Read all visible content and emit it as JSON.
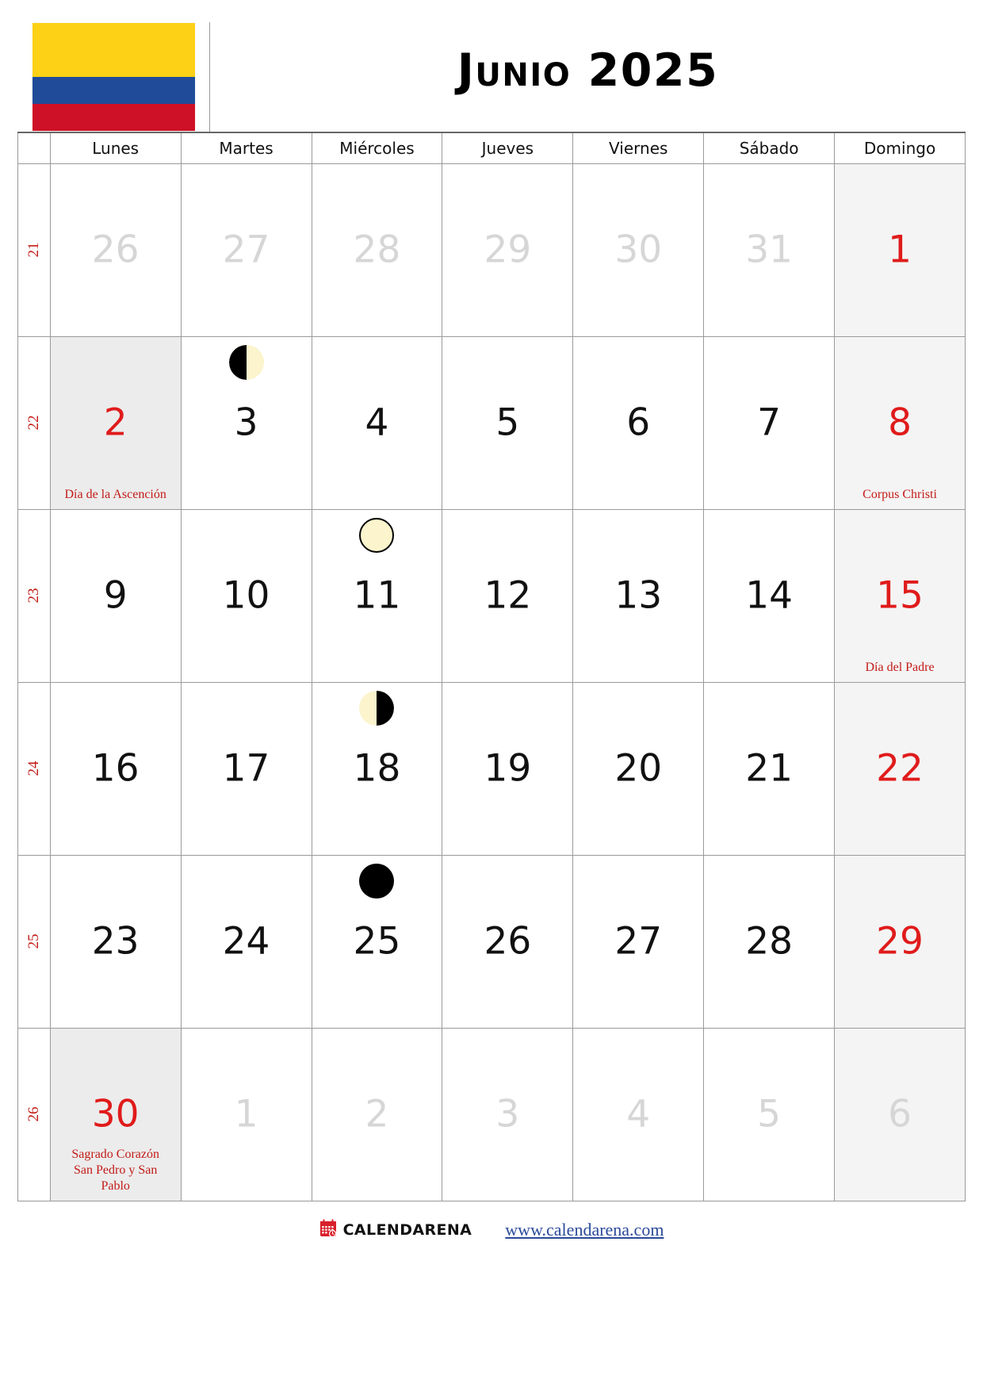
{
  "header": {
    "title": "Junio 2025",
    "flag": {
      "name": "colombia-flag",
      "colors": [
        "#FCD116",
        "#1F4B99",
        "#CE1126"
      ]
    }
  },
  "weekday_headers": [
    "Lunes",
    "Martes",
    "Miércoles",
    "Jueves",
    "Viernes",
    "Sábado",
    "Domingo"
  ],
  "week_number_header": "",
  "colors": {
    "holiday_text": "#c21b17",
    "sunday_number": "#e01b1b",
    "other_month_number": "#d6d6d6",
    "sunday_background": "#f4f4f4",
    "holiday_background": "#ececec",
    "week_number": "#c21b17",
    "link": "#2b4a9b"
  },
  "weeks": [
    {
      "week_number": "21",
      "days": [
        {
          "num": "26",
          "type": "other"
        },
        {
          "num": "27",
          "type": "other"
        },
        {
          "num": "28",
          "type": "other"
        },
        {
          "num": "29",
          "type": "other"
        },
        {
          "num": "30",
          "type": "other"
        },
        {
          "num": "31",
          "type": "other"
        },
        {
          "num": "1",
          "type": "sunday"
        }
      ]
    },
    {
      "week_number": "22",
      "days": [
        {
          "num": "2",
          "type": "holiday",
          "holiday": "Día de la Ascención"
        },
        {
          "num": "3",
          "type": "normal",
          "moon": "first-quarter",
          "moon_label": "first-quarter-moon"
        },
        {
          "num": "4",
          "type": "normal"
        },
        {
          "num": "5",
          "type": "normal"
        },
        {
          "num": "6",
          "type": "normal"
        },
        {
          "num": "7",
          "type": "normal"
        },
        {
          "num": "8",
          "type": "sunday",
          "holiday": "Corpus Christi"
        }
      ]
    },
    {
      "week_number": "23",
      "days": [
        {
          "num": "9",
          "type": "normal"
        },
        {
          "num": "10",
          "type": "normal"
        },
        {
          "num": "11",
          "type": "normal",
          "moon": "full",
          "moon_label": "full-moon"
        },
        {
          "num": "12",
          "type": "normal"
        },
        {
          "num": "13",
          "type": "normal"
        },
        {
          "num": "14",
          "type": "normal"
        },
        {
          "num": "15",
          "type": "sunday",
          "holiday": "Día del Padre"
        }
      ]
    },
    {
      "week_number": "24",
      "days": [
        {
          "num": "16",
          "type": "normal"
        },
        {
          "num": "17",
          "type": "normal"
        },
        {
          "num": "18",
          "type": "normal",
          "moon": "last-quarter",
          "moon_label": "last-quarter-moon"
        },
        {
          "num": "19",
          "type": "normal"
        },
        {
          "num": "20",
          "type": "normal"
        },
        {
          "num": "21",
          "type": "normal"
        },
        {
          "num": "22",
          "type": "sunday"
        }
      ]
    },
    {
      "week_number": "25",
      "days": [
        {
          "num": "23",
          "type": "normal"
        },
        {
          "num": "24",
          "type": "normal"
        },
        {
          "num": "25",
          "type": "normal",
          "moon": "new",
          "moon_label": "new-moon"
        },
        {
          "num": "26",
          "type": "normal"
        },
        {
          "num": "27",
          "type": "normal"
        },
        {
          "num": "28",
          "type": "normal"
        },
        {
          "num": "29",
          "type": "sunday"
        }
      ]
    },
    {
      "week_number": "26",
      "days": [
        {
          "num": "30",
          "type": "holiday",
          "holiday": "Sagrado Corazón\nSan Pedro y San\nPablo"
        },
        {
          "num": "1",
          "type": "other"
        },
        {
          "num": "2",
          "type": "other"
        },
        {
          "num": "3",
          "type": "other"
        },
        {
          "num": "4",
          "type": "other"
        },
        {
          "num": "5",
          "type": "other"
        },
        {
          "num": "6",
          "type": "other-sunday"
        }
      ]
    }
  ],
  "footer": {
    "icon_name": "calendar-icon",
    "brand": "CALENDARENA",
    "url": "www.calendarena.com"
  }
}
